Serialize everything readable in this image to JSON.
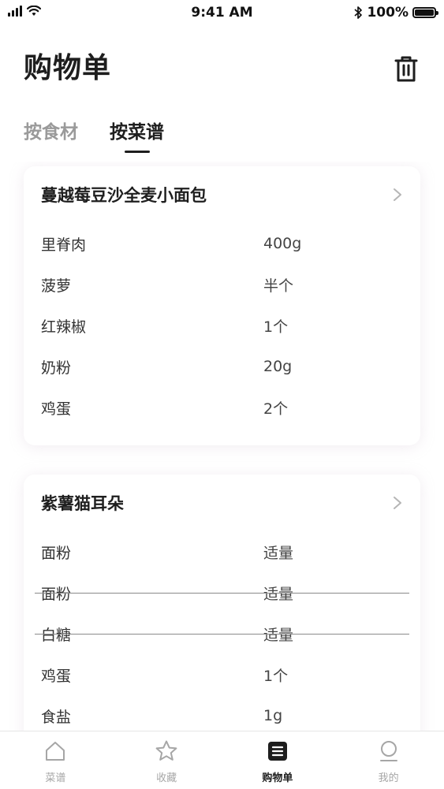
{
  "status_bar": {
    "time": "9:41 AM",
    "battery": "100%"
  },
  "header": {
    "title": "购物单"
  },
  "tabs": [
    {
      "label": "按食材",
      "active": false
    },
    {
      "label": "按菜谱",
      "active": true
    }
  ],
  "recipes": [
    {
      "title": "蔓越莓豆沙全麦小面包",
      "items": [
        {
          "name": "里脊肉",
          "amount": "400g",
          "checked": false
        },
        {
          "name": "菠萝",
          "amount": "半个",
          "checked": false
        },
        {
          "name": "红辣椒",
          "amount": "1个",
          "checked": false
        },
        {
          "name": "奶粉",
          "amount": "20g",
          "checked": false
        },
        {
          "name": "鸡蛋",
          "amount": "2个",
          "checked": false
        }
      ]
    },
    {
      "title": "紫薯猫耳朵",
      "items": [
        {
          "name": "面粉",
          "amount": "适量",
          "checked": false
        },
        {
          "name": "面粉",
          "amount": "适量",
          "checked": true
        },
        {
          "name": "白糖",
          "amount": "适量",
          "checked": true
        },
        {
          "name": "鸡蛋",
          "amount": "1个",
          "checked": false
        },
        {
          "name": "食盐",
          "amount": "1g",
          "checked": false
        }
      ]
    }
  ],
  "bottom_nav": [
    {
      "label": "菜谱",
      "icon": "home-icon",
      "active": false
    },
    {
      "label": "收藏",
      "icon": "star-icon",
      "active": false
    },
    {
      "label": "购物单",
      "icon": "list-icon",
      "active": true
    },
    {
      "label": "我的",
      "icon": "profile-icon",
      "active": false
    }
  ]
}
